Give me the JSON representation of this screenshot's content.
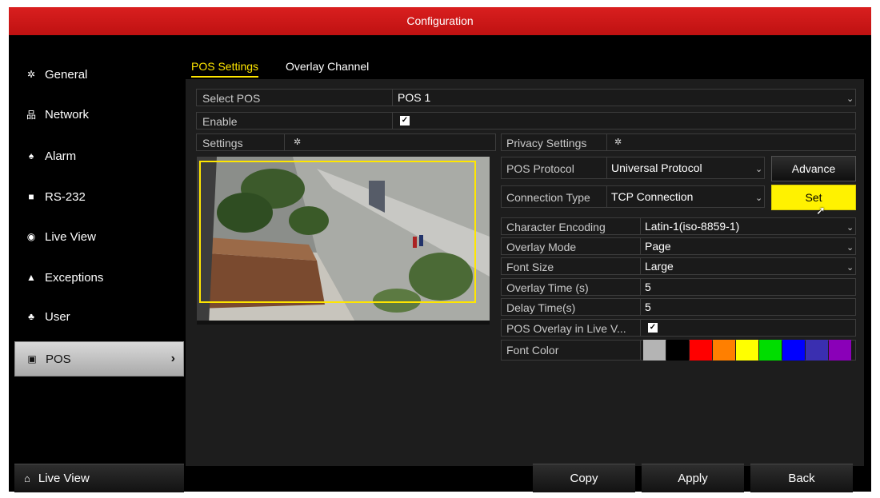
{
  "window": {
    "title": "Configuration"
  },
  "sidebar": {
    "items": [
      {
        "label": "General",
        "icon": "gear-icon"
      },
      {
        "label": "Network",
        "icon": "network-icon"
      },
      {
        "label": "Alarm",
        "icon": "alarm-icon"
      },
      {
        "label": "RS-232",
        "icon": "serial-port-icon"
      },
      {
        "label": "Live View",
        "icon": "eye-icon"
      },
      {
        "label": "Exceptions",
        "icon": "warning-icon"
      },
      {
        "label": "User",
        "icon": "users-icon"
      },
      {
        "label": "POS",
        "icon": "pos-icon",
        "active": true
      }
    ],
    "live_view_button": "Live View"
  },
  "tabs": [
    {
      "label": "POS Settings",
      "active": true
    },
    {
      "label": "Overlay Channel",
      "active": false
    }
  ],
  "form": {
    "select_pos": {
      "label": "Select POS",
      "value": "POS 1"
    },
    "enable": {
      "label": "Enable",
      "checked": true
    },
    "settings_label": "Settings",
    "privacy_label": "Privacy Settings",
    "pos_protocol": {
      "label": "POS Protocol",
      "value": "Universal Protocol"
    },
    "connection_type": {
      "label": "Connection Type",
      "value": "TCP Connection"
    },
    "advance_button": "Advance",
    "set_button": "Set",
    "character_encoding": {
      "label": "Character Encoding",
      "value": "Latin-1(iso-8859-1)"
    },
    "overlay_mode": {
      "label": "Overlay Mode",
      "value": "Page"
    },
    "font_size": {
      "label": "Font Size",
      "value": "Large"
    },
    "overlay_time": {
      "label": "Overlay Time (s)",
      "value": "5"
    },
    "delay_time": {
      "label": "Delay Time(s)",
      "value": "5"
    },
    "pos_overlay_live": {
      "label": "POS Overlay in Live V...",
      "checked": true
    },
    "font_color": {
      "label": "Font Color",
      "colors": [
        "#b4b4b4",
        "#000000",
        "#ff0000",
        "#ff7f00",
        "#ffff00",
        "#00dd00",
        "#0000ff",
        "#3a2fb0",
        "#8a00b8"
      ]
    }
  },
  "footer": {
    "copy": "Copy",
    "apply": "Apply",
    "back": "Back"
  },
  "colors": {
    "accent": "#d01818",
    "highlight": "#fff200",
    "active_tab": "#ffe600"
  }
}
